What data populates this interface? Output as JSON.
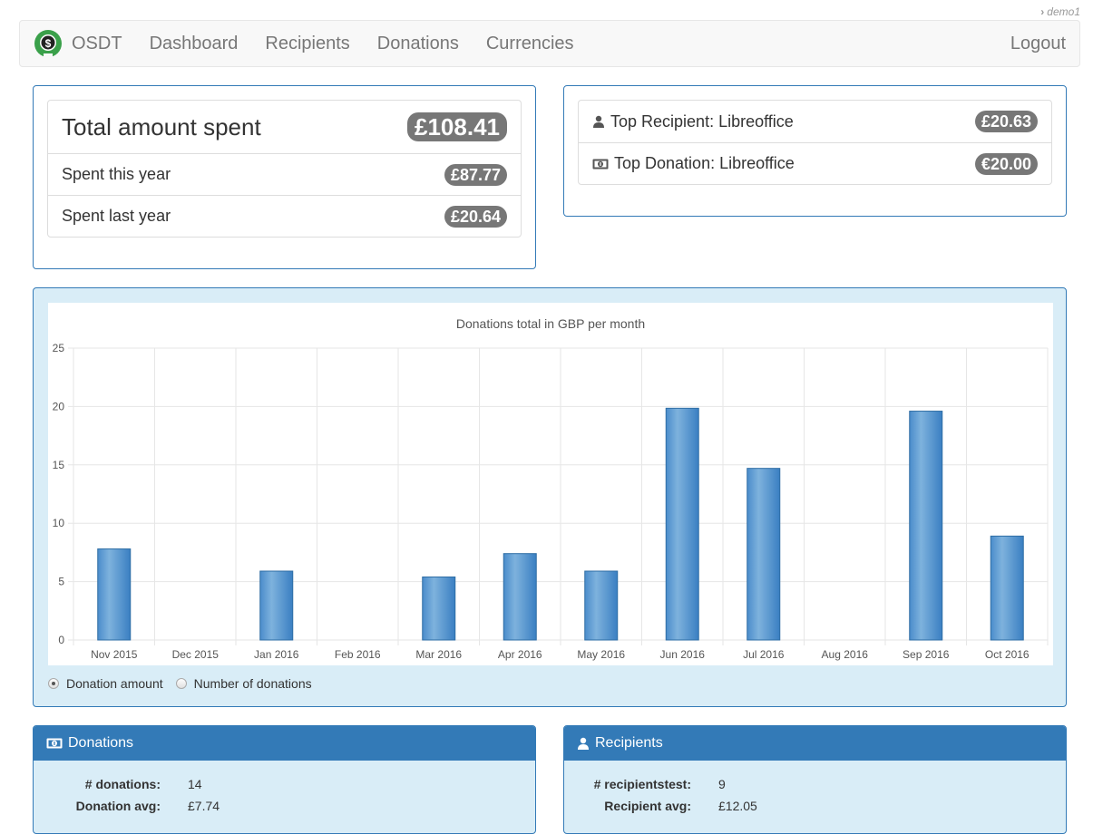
{
  "user": {
    "name": "demo1"
  },
  "nav": {
    "brand": "OSDT",
    "items": [
      {
        "label": "Dashboard"
      },
      {
        "label": "Recipients"
      },
      {
        "label": "Donations"
      },
      {
        "label": "Currencies"
      }
    ],
    "logout": "Logout"
  },
  "totals": {
    "total_label": "Total amount spent",
    "total_value": "£108.41",
    "this_year_label": "Spent this year",
    "this_year_value": "£87.77",
    "last_year_label": "Spent last year",
    "last_year_value": "£20.64"
  },
  "tops": {
    "recipient_label": "Top Recipient: Libreoffice",
    "recipient_value": "£20.63",
    "donation_label": "Top Donation: Libreoffice",
    "donation_value": "€20.00"
  },
  "chart_toggle": {
    "options": [
      {
        "label": "Donation amount",
        "checked": true
      },
      {
        "label": "Number of donations",
        "checked": false
      }
    ]
  },
  "donations_panel": {
    "title": "Donations",
    "rows": [
      {
        "key": "# donations:",
        "value": "14"
      },
      {
        "key": "Donation avg:",
        "value": "£7.74"
      }
    ]
  },
  "recipients_panel": {
    "title": "Recipients",
    "rows": [
      {
        "key": "# recipientstest:",
        "value": "9"
      },
      {
        "key": "Recipient avg:",
        "value": "£12.05"
      }
    ]
  },
  "colors": {
    "primary": "#337ab7",
    "panel_bg": "#d9edf7",
    "badge": "#777777",
    "bar": "#4a8ccb",
    "logo_green": "#3aa04a"
  },
  "chart_data": {
    "type": "bar",
    "title": "Donations total in GBP per month",
    "xlabel": "",
    "ylabel": "",
    "categories": [
      "Nov 2015",
      "Dec 2015",
      "Jan 2016",
      "Feb 2016",
      "Mar 2016",
      "Apr 2016",
      "May 2016",
      "Jun 2016",
      "Jul 2016",
      "Aug 2016",
      "Sep 2016",
      "Oct 2016"
    ],
    "values": [
      7.8,
      0,
      5.9,
      0,
      5.4,
      7.4,
      5.9,
      19.85,
      14.7,
      0,
      19.6,
      8.9
    ],
    "ylim": [
      0,
      25
    ],
    "yticks": [
      0,
      5,
      10,
      15,
      20,
      25
    ],
    "grid": true,
    "legend": "none"
  }
}
